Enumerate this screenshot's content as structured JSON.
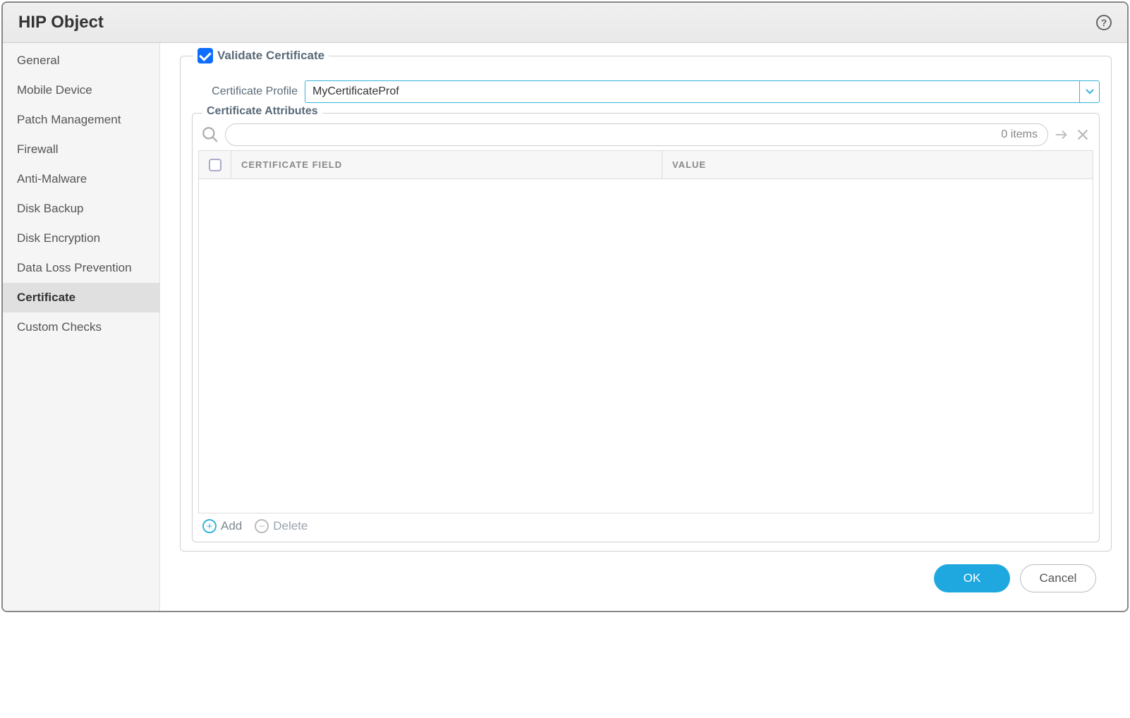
{
  "dialog": {
    "title": "HIP Object"
  },
  "sidebar": {
    "items": [
      {
        "label": "General",
        "active": false
      },
      {
        "label": "Mobile Device",
        "active": false
      },
      {
        "label": "Patch Management",
        "active": false
      },
      {
        "label": "Firewall",
        "active": false
      },
      {
        "label": "Anti-Malware",
        "active": false
      },
      {
        "label": "Disk Backup",
        "active": false
      },
      {
        "label": "Disk Encryption",
        "active": false
      },
      {
        "label": "Data Loss Prevention",
        "active": false
      },
      {
        "label": "Certificate",
        "active": true
      },
      {
        "label": "Custom Checks",
        "active": false
      }
    ]
  },
  "validate": {
    "legend": "Validate Certificate",
    "checked": true,
    "profile_label": "Certificate Profile",
    "profile_value": "MyCertificateProf"
  },
  "attributes": {
    "legend": "Certificate Attributes",
    "items_text": "0 items",
    "columns": {
      "field": "CERTIFICATE FIELD",
      "value": "VALUE"
    },
    "rows": []
  },
  "actions": {
    "add": "Add",
    "delete": "Delete"
  },
  "footer": {
    "ok": "OK",
    "cancel": "Cancel"
  }
}
